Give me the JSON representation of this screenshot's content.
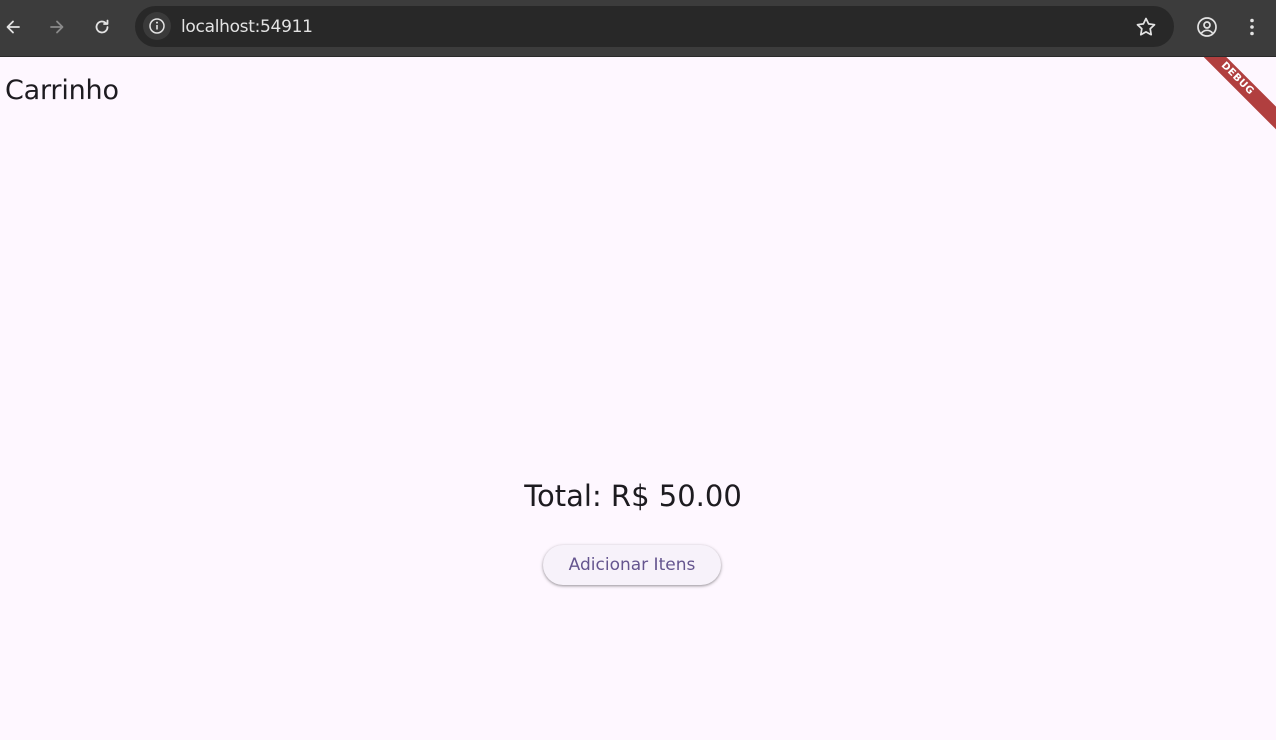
{
  "browser": {
    "url": "localhost:54911",
    "back_icon": "arrow-left-icon",
    "forward_icon": "arrow-right-icon",
    "reload_icon": "reload-icon",
    "info_icon": "info-icon",
    "bookmark_icon": "star-icon",
    "profile_icon": "account-circle-icon",
    "menu_icon": "kebab-menu-icon"
  },
  "app": {
    "title": "Carrinho",
    "total_label": "Total: R$ 50.00",
    "add_button_label": "Adicionar Itens",
    "debug_banner": "DEBUG"
  },
  "colors": {
    "background": "#fef7ff",
    "button_text": "#65558f",
    "debug_banner": "#b13f3f"
  }
}
